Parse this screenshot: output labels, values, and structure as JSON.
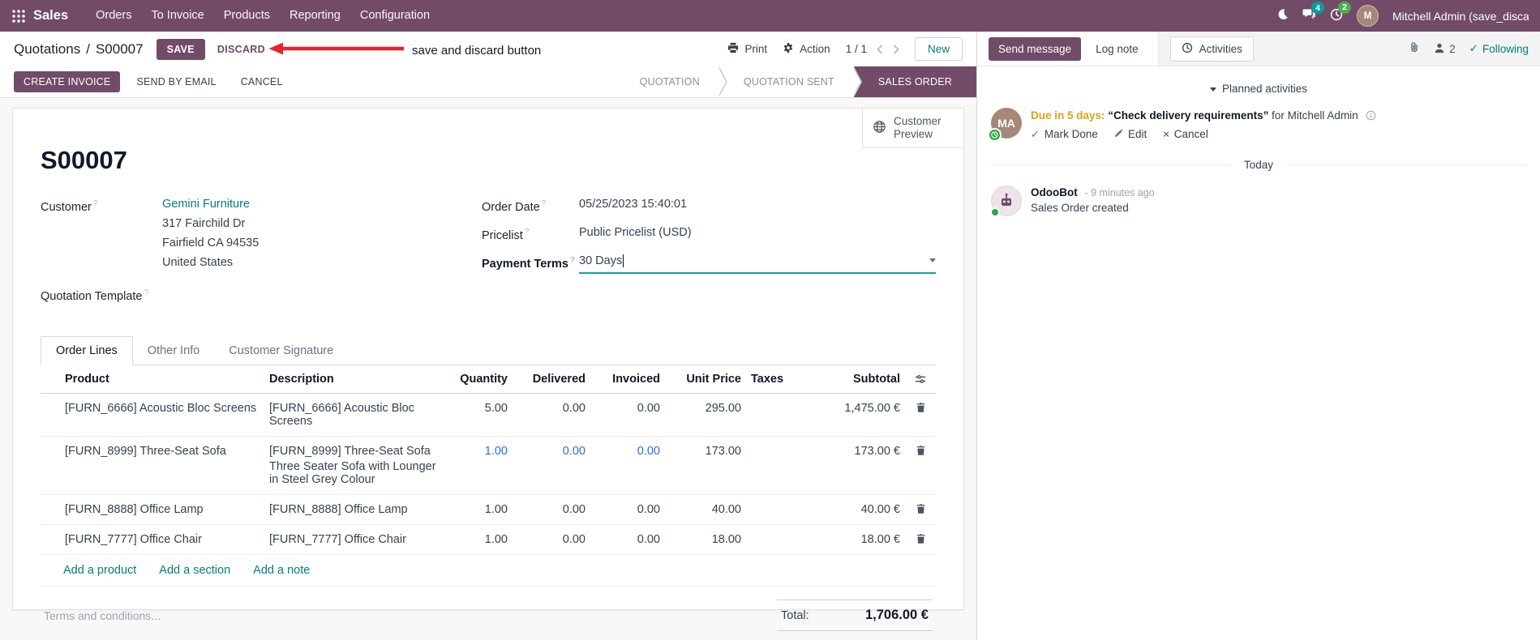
{
  "colors": {
    "brand": "#714B67",
    "link_teal": "#017e84",
    "edited_blue": "#2b6cd9",
    "annotation_red": "#e8212e",
    "activity_due_warning": "#d9a21b",
    "online_green": "#28a745",
    "statusbar_active_bg": "#714B67"
  },
  "icons": {
    "apps": "grid-dots",
    "dark_mode": "moon",
    "messages": "chat-bubbles",
    "activities_tray": "clock",
    "print": "printer",
    "action": "gear",
    "pager_prev": "chevron-left",
    "pager_next": "chevron-right",
    "customer_preview": "globe",
    "optional_columns": "sliders",
    "row_drag": "dots-handle",
    "row_delete": "trash",
    "attachments": "paperclip",
    "followers": "person",
    "following": "check",
    "mark_done": "check",
    "edit": "pencil",
    "cancel_activity": "x",
    "activity_info": "info-circle",
    "payment_terms_dropdown": "caret-down",
    "planned_collapse": "caret-down",
    "help": "?"
  },
  "nav": {
    "app_name": "Sales",
    "menus": [
      "Orders",
      "To Invoice",
      "Products",
      "Reporting",
      "Configuration"
    ],
    "messages_badge": "4",
    "activities_badge": "2",
    "avatar_initial": "M",
    "user_name": "Mitchell Admin (save_discar"
  },
  "control_panel": {
    "breadcrumb_parent": "Quotations",
    "breadcrumb_sep": "/",
    "breadcrumb_current": "S00007",
    "save": "SAVE",
    "discard": "DISCARD",
    "print": "Print",
    "action": "Action",
    "pager": "1 / 1",
    "new": "New"
  },
  "annotation": {
    "text": "save and discard button"
  },
  "status_buttons": [
    "CREATE INVOICE",
    "SEND BY EMAIL",
    "CANCEL"
  ],
  "statusbar": {
    "steps": [
      "QUOTATION",
      "QUOTATION SENT",
      "SALES ORDER"
    ],
    "active": "SALES ORDER"
  },
  "sheet": {
    "customer_preview": "Customer Preview",
    "title": "S00007",
    "fields": {
      "customer_label": "Customer",
      "customer_name": "Gemini Furniture",
      "customer_address": [
        "317 Fairchild Dr",
        "Fairfield CA 94535",
        "United States"
      ],
      "quotation_template_label": "Quotation Template",
      "order_date_label": "Order Date",
      "order_date": "05/25/2023 15:40:01",
      "pricelist_label": "Pricelist",
      "pricelist": "Public Pricelist (USD)",
      "payment_terms_label": "Payment Terms",
      "payment_terms": "30 Days"
    },
    "tabs": [
      "Order Lines",
      "Other Info",
      "Customer Signature"
    ],
    "order_lines": {
      "headers": [
        "Product",
        "Description",
        "Quantity",
        "Delivered",
        "Invoiced",
        "Unit Price",
        "Taxes",
        "Subtotal"
      ],
      "rows": [
        {
          "product": "[FURN_6666] Acoustic Bloc Screens",
          "description": "[FURN_6666] Acoustic Bloc Screens",
          "description2": "",
          "quantity": "5.00",
          "delivered": "0.00",
          "invoiced": "0.00",
          "unit_price": "295.00",
          "taxes": "",
          "subtotal": "1,475.00 €",
          "edited": false
        },
        {
          "product": "[FURN_8999] Three-Seat Sofa",
          "description": "[FURN_8999] Three-Seat Sofa",
          "description2": "Three Seater Sofa with Lounger in Steel Grey Colour",
          "quantity": "1.00",
          "delivered": "0.00",
          "invoiced": "0.00",
          "unit_price": "173.00",
          "taxes": "",
          "subtotal": "173.00 €",
          "edited": true
        },
        {
          "product": "[FURN_8888] Office Lamp",
          "description": "[FURN_8888] Office Lamp",
          "description2": "",
          "quantity": "1.00",
          "delivered": "0.00",
          "invoiced": "0.00",
          "unit_price": "40.00",
          "taxes": "",
          "subtotal": "40.00 €",
          "edited": false
        },
        {
          "product": "[FURN_7777] Office Chair",
          "description": "[FURN_7777] Office Chair",
          "description2": "",
          "quantity": "1.00",
          "delivered": "0.00",
          "invoiced": "0.00",
          "unit_price": "18.00",
          "taxes": "",
          "subtotal": "18.00 €",
          "edited": false
        }
      ],
      "footer_links": [
        "Add a product",
        "Add a section",
        "Add a note"
      ],
      "terms_placeholder": "Terms and conditions...",
      "total_label": "Total:",
      "total_value": "1,706.00 €"
    }
  },
  "chatter": {
    "send_message": "Send message",
    "log_note": "Log note",
    "activities_tab": "Activities",
    "followers_count": "2",
    "following": "Following",
    "following_check": "✓",
    "planned_header": "Planned activities",
    "activity": {
      "due": "Due in 5 days:",
      "summary": "“Check delivery requirements”",
      "assignee": "for Mitchell Admin",
      "mark_done_check": "✓",
      "mark_done": "Mark Done",
      "edit": "Edit",
      "cancel_x": "×",
      "cancel": "Cancel"
    },
    "date_divider": "Today",
    "message": {
      "author": "OdooBot",
      "time": "- 9 minutes ago",
      "body": "Sales Order created"
    }
  }
}
